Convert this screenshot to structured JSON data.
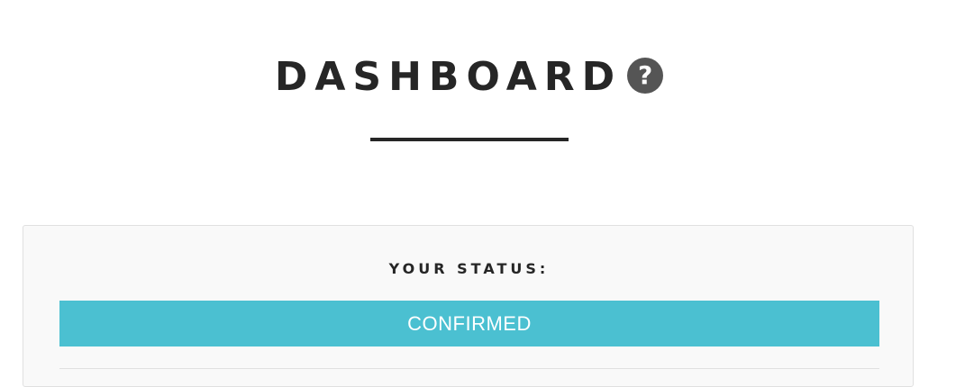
{
  "header": {
    "title": "DASHBOARD",
    "help_icon_glyph": "?",
    "help_icon": "question-circle-icon"
  },
  "status": {
    "label": "YOUR STATUS:",
    "value": "CONFIRMED",
    "badge_color": "#4bc0d1"
  },
  "colors": {
    "title_text": "#262626",
    "card_background": "#f9f9f9",
    "help_icon_bg": "#555555"
  }
}
